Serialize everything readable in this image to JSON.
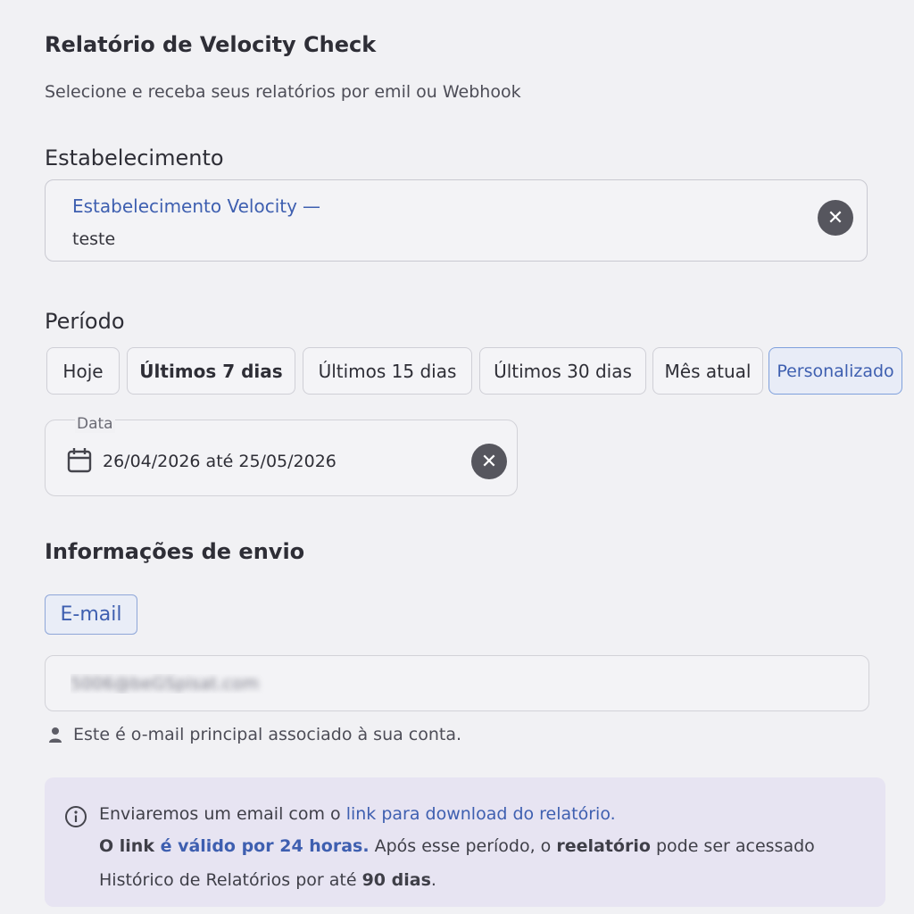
{
  "header": {
    "title": "Relatório de Velocity Check",
    "subtitle": "Selecione e receba seus relatórios por emil ou Webhook"
  },
  "establishment": {
    "section_title": "Estabelecimento",
    "selected_name": "Estabelecimento Velocity",
    "separator": "—",
    "selected_detail": "teste",
    "clear_icon": "close-circle-icon"
  },
  "period": {
    "section_title": "Período",
    "options": [
      {
        "label": "Hoje"
      },
      {
        "label": "Últimos 7 dias"
      },
      {
        "label": "Últimos 15 dias"
      },
      {
        "label": "Últimos 30 dias"
      },
      {
        "label": "Mês atual"
      },
      {
        "label": "Personalizado"
      }
    ],
    "selected": "Personalizado",
    "date": {
      "label": "Data",
      "value": "26/04/2026 até 25/05/2026",
      "icon": "calendar-icon",
      "clear_icon": "close-circle-icon"
    }
  },
  "delivery": {
    "section_title": "Informações de envio",
    "method_tag": "E-mail",
    "email_value": "5006@beGSpisat.com",
    "hint": "Este é o-mail principal associado à sua conta.",
    "hint_icon": "user-icon"
  },
  "info": {
    "icon": "info-icon",
    "line1_prefix": "Enviaremos um email com o ",
    "line1_link": "link para download do relatório",
    "line1_suffix": ".",
    "line2_a": "O link",
    "line2_b": " é válido por 24 horas.",
    "line2_c": " Após esse período, o ",
    "line2_d": "reelatório",
    "line2_e": " pode ser acessado",
    "line3_a": "Histórico de Relatórios por até ",
    "line3_b": "90 dias",
    "line3_c": "."
  },
  "colors": {
    "accent": "#3e5fb0",
    "background": "#f1f1f4",
    "info_background": "#e7e4f2"
  }
}
